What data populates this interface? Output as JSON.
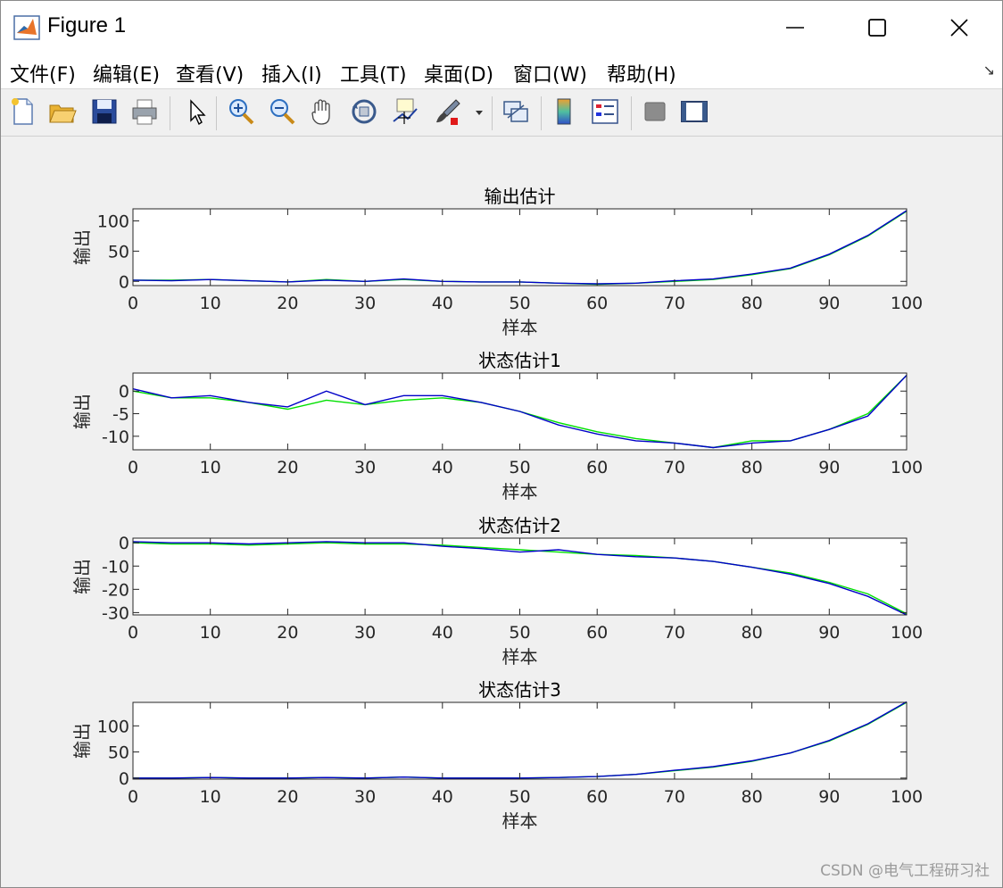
{
  "window": {
    "title": "Figure 1",
    "controls": {
      "minimize_icon": "minimize-icon",
      "maximize_icon": "maximize-icon",
      "close_icon": "close-icon"
    }
  },
  "menu": [
    {
      "label": "文件(F)",
      "name": "menu-file"
    },
    {
      "label": "编辑(E)",
      "name": "menu-edit"
    },
    {
      "label": "查看(V)",
      "name": "menu-view"
    },
    {
      "label": "插入(I)",
      "name": "menu-insert"
    },
    {
      "label": "工具(T)",
      "name": "menu-tools"
    },
    {
      "label": "桌面(D)",
      "name": "menu-desktop"
    },
    {
      "label": "窗口(W)",
      "name": "menu-window"
    },
    {
      "label": "帮助(H)",
      "name": "menu-help"
    }
  ],
  "toolbar": {
    "icons": [
      "new-figure-icon",
      "open-file-icon",
      "save-icon",
      "print-icon",
      "pointer-icon",
      "zoom-in-icon",
      "zoom-out-icon",
      "pan-icon",
      "rotate-3d-icon",
      "data-cursor-icon",
      "brush-icon",
      "link-plot-icon",
      "colorbar-icon",
      "legend-icon",
      "hide-plot-tools-icon",
      "show-plot-tools-icon"
    ]
  },
  "colors": {
    "true_line": "#00e000",
    "estimate_line": "#0000c8",
    "axes": "#262626"
  },
  "watermark": "CSDN @电气工程研习社",
  "chart_data": [
    {
      "type": "line",
      "title": "输出估计",
      "xlabel": "样本",
      "ylabel": "输出",
      "xlim": [
        0,
        100
      ],
      "ylim": [
        -7,
        120
      ],
      "xticks": [
        0,
        10,
        20,
        30,
        40,
        50,
        60,
        70,
        80,
        90,
        100
      ],
      "yticks": [
        0,
        50,
        100
      ],
      "x": [
        0,
        5,
        10,
        15,
        20,
        25,
        30,
        35,
        40,
        45,
        50,
        55,
        60,
        65,
        70,
        75,
        80,
        85,
        90,
        95,
        100
      ],
      "series": [
        {
          "color": "#00e000",
          "values": [
            2,
            2,
            3,
            1,
            -1,
            3,
            0,
            3,
            0,
            -1,
            -1,
            -3,
            -5,
            -3,
            0,
            3,
            11,
            21,
            44,
            75,
            116
          ]
        },
        {
          "color": "#0000c8",
          "values": [
            2,
            1,
            3,
            1,
            -1,
            2,
            0,
            4,
            0,
            -1,
            -1,
            -3,
            -4,
            -3,
            1,
            4,
            12,
            22,
            45,
            76,
            117
          ]
        }
      ]
    },
    {
      "type": "line",
      "title": "状态估计1",
      "xlabel": "样本",
      "ylabel": "输出",
      "xlim": [
        0,
        100
      ],
      "ylim": [
        -13,
        4
      ],
      "xticks": [
        0,
        10,
        20,
        30,
        40,
        50,
        60,
        70,
        80,
        90,
        100
      ],
      "yticks": [
        0,
        -5,
        -10
      ],
      "x": [
        0,
        5,
        10,
        15,
        20,
        25,
        30,
        35,
        40,
        45,
        50,
        55,
        60,
        65,
        70,
        75,
        80,
        85,
        90,
        95,
        100
      ],
      "series": [
        {
          "color": "#00e000",
          "values": [
            0,
            -1.5,
            -1.5,
            -2.5,
            -4,
            -2,
            -3,
            -2,
            -1.5,
            -2.5,
            -4.5,
            -7,
            -9,
            -10.5,
            -11.5,
            -12.5,
            -11,
            -11,
            -8.5,
            -5,
            3.5
          ]
        },
        {
          "color": "#0000c8",
          "values": [
            0.5,
            -1.5,
            -1,
            -2.5,
            -3.5,
            0,
            -3,
            -1,
            -1,
            -2.5,
            -4.5,
            -7.5,
            -9.5,
            -11,
            -11.5,
            -12.5,
            -11.5,
            -11,
            -8.5,
            -5.5,
            3.5
          ]
        }
      ]
    },
    {
      "type": "line",
      "title": "状态估计2",
      "xlabel": "样本",
      "ylabel": "输出",
      "xlim": [
        0,
        100
      ],
      "ylim": [
        -31,
        2
      ],
      "xticks": [
        0,
        10,
        20,
        30,
        40,
        50,
        60,
        70,
        80,
        90,
        100
      ],
      "yticks": [
        0,
        -10,
        -20,
        -30
      ],
      "x": [
        0,
        5,
        10,
        15,
        20,
        25,
        30,
        35,
        40,
        45,
        50,
        55,
        60,
        65,
        70,
        75,
        80,
        85,
        90,
        95,
        100
      ],
      "series": [
        {
          "color": "#00e000",
          "values": [
            0,
            -0.5,
            -0.5,
            -1,
            -0.5,
            0,
            -0.5,
            -0.5,
            -1,
            -2,
            -3,
            -4,
            -5,
            -5.5,
            -6.5,
            -8,
            -10.5,
            -13,
            -17,
            -22,
            -30.5
          ]
        },
        {
          "color": "#0000c8",
          "values": [
            0.5,
            0,
            0,
            -0.5,
            0,
            0.5,
            0,
            0,
            -1.5,
            -2.5,
            -4,
            -3,
            -5,
            -6,
            -6.5,
            -8,
            -10.5,
            -13.5,
            -17.5,
            -23,
            -31
          ]
        }
      ]
    },
    {
      "type": "line",
      "title": "状态估计3",
      "xlabel": "样本",
      "ylabel": "输出",
      "xlim": [
        0,
        100
      ],
      "ylim": [
        -2,
        145
      ],
      "xticks": [
        0,
        10,
        20,
        30,
        40,
        50,
        60,
        70,
        80,
        90,
        100
      ],
      "yticks": [
        0,
        50,
        100
      ],
      "x": [
        0,
        5,
        10,
        15,
        20,
        25,
        30,
        35,
        40,
        45,
        50,
        55,
        60,
        65,
        70,
        75,
        80,
        85,
        90,
        95,
        100
      ],
      "series": [
        {
          "color": "#00e000",
          "values": [
            0,
            0,
            1,
            0,
            0,
            1,
            0,
            2,
            0,
            0,
            0,
            1,
            3,
            7,
            14,
            21,
            32,
            48,
            71,
            103,
            145
          ]
        },
        {
          "color": "#0000c8",
          "values": [
            0,
            0,
            1,
            0,
            0,
            1,
            0,
            2,
            0,
            0,
            0,
            1,
            3,
            7,
            15,
            22,
            33,
            48,
            72,
            104,
            146
          ]
        }
      ]
    }
  ]
}
